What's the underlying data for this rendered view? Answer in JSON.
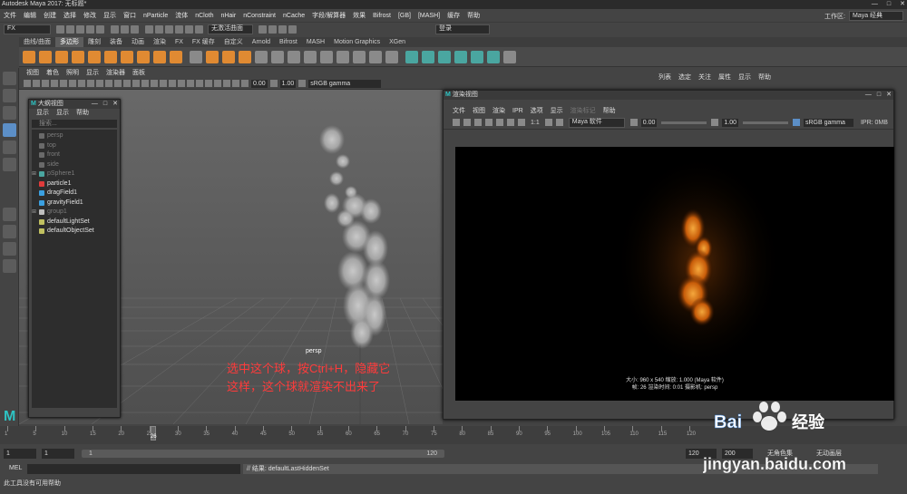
{
  "title_bar": {
    "text": "Autodesk Maya 2017: 无标题*",
    "minimize": "—",
    "maximize": "□",
    "close": "✕"
  },
  "menu": {
    "items": [
      "文件",
      "编辑",
      "创建",
      "选择",
      "修改",
      "显示",
      "窗口",
      "nParticle",
      "流体",
      "nCloth",
      "nHair",
      "nConstraint",
      "nCache",
      "字段/解算器",
      "效果",
      "Bifrost",
      "[GB]",
      "[MASH]",
      "缓存",
      "帮助"
    ],
    "workspace_label": "工作区:",
    "workspace_value": "Maya 经典"
  },
  "status_line": {
    "mode": "FX",
    "live_surface": "无激活曲面",
    "login": "登录"
  },
  "shelf": {
    "tabs": [
      "曲线/曲面",
      "多边形",
      "雕刻",
      "装备",
      "动画",
      "渲染",
      "FX",
      "FX 缓存",
      "自定义",
      "Arnold",
      "Bifrost",
      "MASH",
      "Motion Graphics",
      "XGen"
    ],
    "active_tab": "多边形"
  },
  "viewport": {
    "menu": [
      "视图",
      "着色",
      "照明",
      "显示",
      "渲染器",
      "面板"
    ],
    "value_a": "0.00",
    "value_b": "1.00",
    "color_space": "sRGB gamma",
    "camera_label": "persp",
    "annotation_line1": "选中这个球，按Ctrl+H，隐藏它",
    "annotation_line2": "这样，这个球就渲染不出来了"
  },
  "outliner": {
    "title": "大纲视图",
    "menu": [
      "显示",
      "显示",
      "帮助"
    ],
    "search_placeholder": "搜索...",
    "items": [
      {
        "label": "persp",
        "dim": true,
        "expand": "",
        "color": "#6a6a6a"
      },
      {
        "label": "top",
        "dim": true,
        "expand": "",
        "color": "#6a6a6a"
      },
      {
        "label": "front",
        "dim": true,
        "expand": "",
        "color": "#6a6a6a"
      },
      {
        "label": "side",
        "dim": true,
        "expand": "",
        "color": "#6a6a6a"
      },
      {
        "label": "pSphere1",
        "dim": true,
        "expand": "⊞",
        "color": "#4aa6a0"
      },
      {
        "label": "particle1",
        "dim": false,
        "expand": "",
        "color": "#e03b3b"
      },
      {
        "label": "dragField1",
        "dim": false,
        "expand": "",
        "color": "#3ba0e0"
      },
      {
        "label": "gravityField1",
        "dim": false,
        "expand": "",
        "color": "#3ba0e0"
      },
      {
        "label": "group1",
        "dim": true,
        "expand": "⊞",
        "color": "#bfbfbf"
      },
      {
        "label": "defaultLightSet",
        "dim": false,
        "expand": "",
        "color": "#c0c060"
      },
      {
        "label": "defaultObjectSet",
        "dim": false,
        "expand": "",
        "color": "#c0c060"
      }
    ]
  },
  "channel_box": {
    "menu": [
      "列表",
      "选定",
      "关注",
      "属性",
      "显示",
      "帮助"
    ]
  },
  "render_view": {
    "title": "渲染视图",
    "menu": [
      "文件",
      "视图",
      "渲染",
      "IPR",
      "选项",
      "显示",
      "渲染标记",
      "帮助"
    ],
    "ratio": "1:1",
    "renderer": "Maya 软件",
    "exposure": "0.00",
    "gamma": "1.00",
    "color_space": "sRGB gamma",
    "ipr": "IPR: 0MB",
    "info_line1": "大小: 960 x 540  缩放: 1.000      (Maya 软件)",
    "info_line2": "帧: 26      渲染时间: 0:01      摄影机: persp"
  },
  "time_slider": {
    "ticks": [
      "1",
      "5",
      "10",
      "15",
      "20",
      "25",
      "30",
      "35",
      "40",
      "45",
      "50",
      "55",
      "60",
      "65",
      "70",
      "75",
      "80",
      "85",
      "90",
      "95",
      "100",
      "105",
      "110",
      "115",
      "120"
    ],
    "current_frame": "26",
    "current_fraction": 0.21
  },
  "range_slider": {
    "start": "1",
    "anim_start": "1",
    "range_start": "1",
    "range_end": "120",
    "end": "120",
    "anim_end": "200",
    "char_set": "无角色集",
    "anim_layer": "无动画层"
  },
  "command_line": {
    "label": "MEL",
    "result": "// 结果: defaultLastHiddenSet"
  },
  "help_line": {
    "text": "此工具没有可用帮助"
  },
  "watermark": {
    "brand": "Bai",
    "brand_jp": "经验",
    "url": "jingyan.baidu.com",
    "colors": {
      "blue": "#2d7bd8",
      "red": "#e02a2a"
    }
  }
}
